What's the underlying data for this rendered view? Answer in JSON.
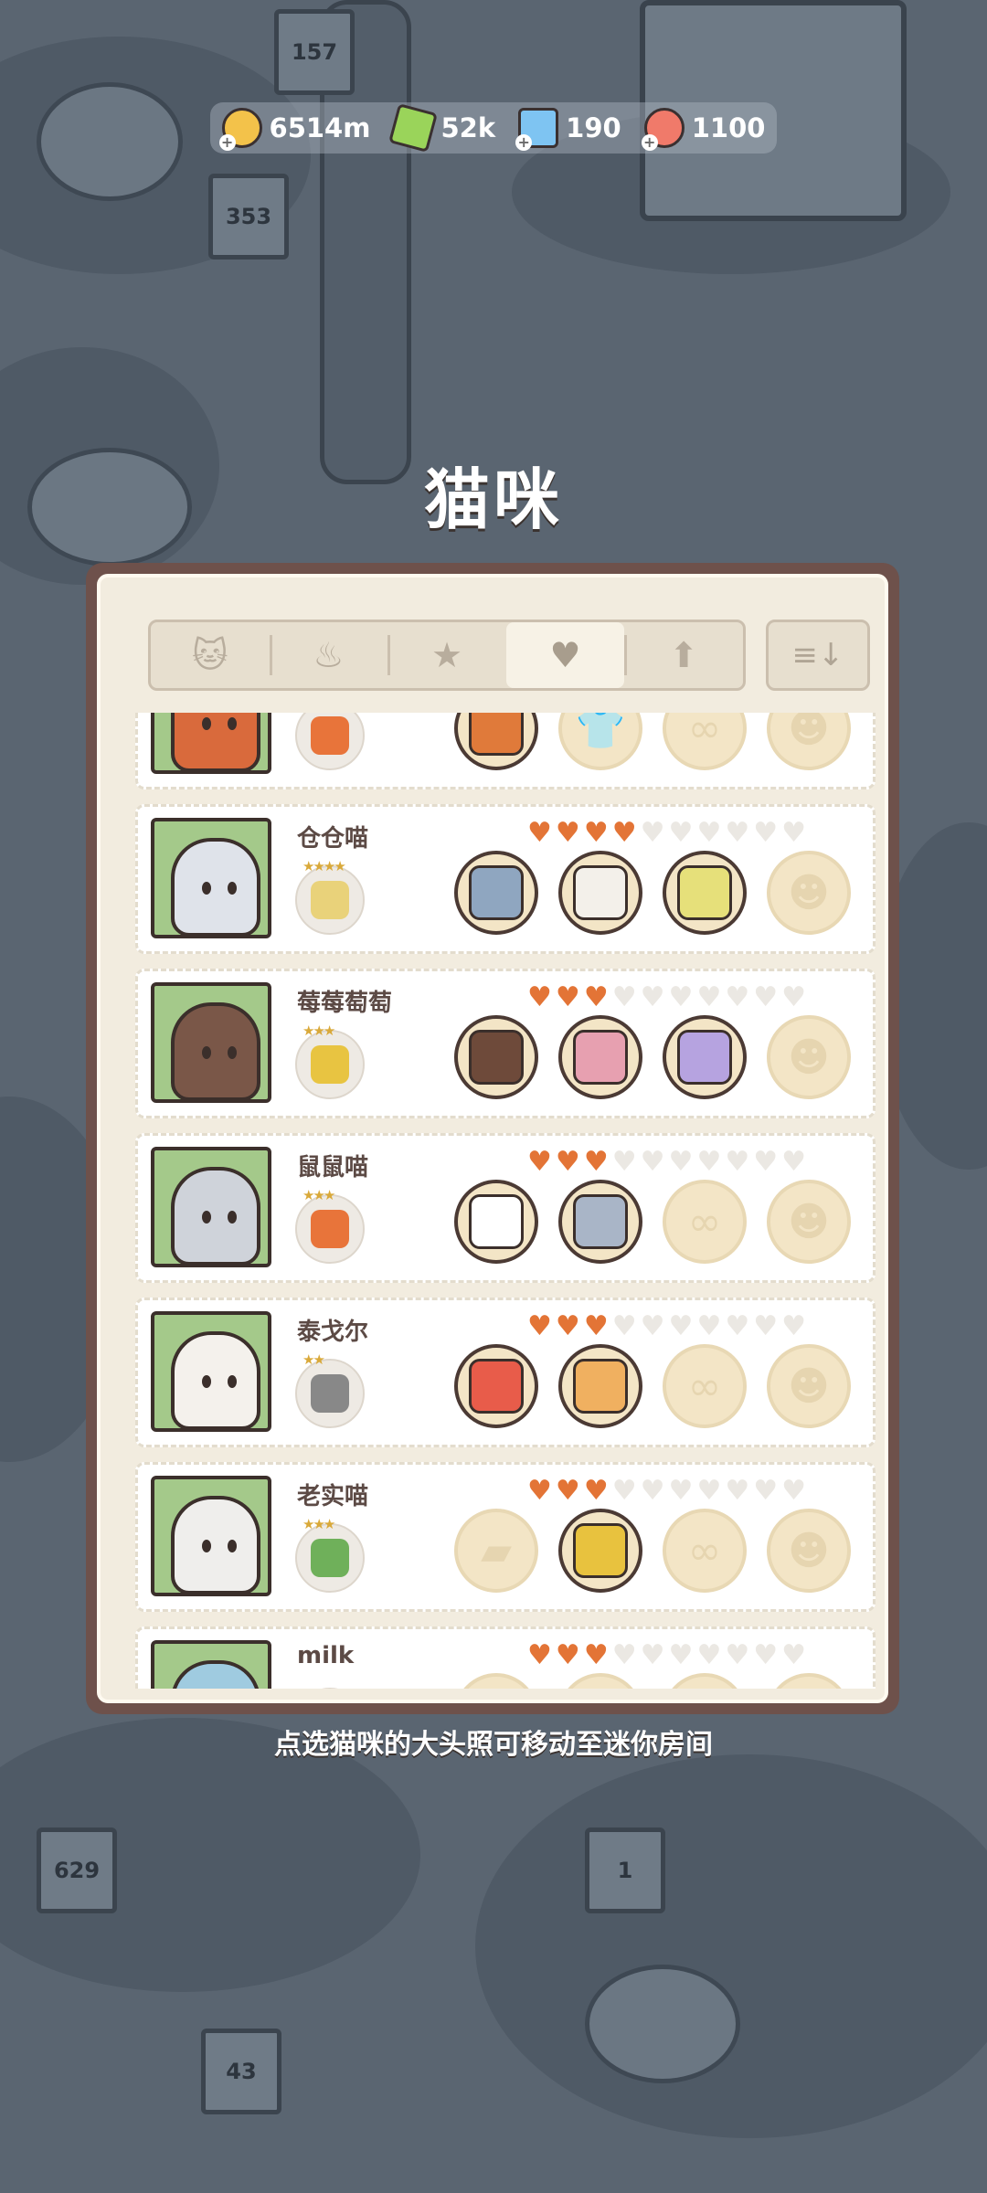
{
  "currency": {
    "coins": "6514m",
    "energy": "52k",
    "gems": "190",
    "shells": "1100"
  },
  "title": "猫咪",
  "tabs": [
    {
      "icon": "cat-icon",
      "glyph": "🐱"
    },
    {
      "icon": "chef-hat-icon",
      "glyph": "♨"
    },
    {
      "icon": "star-icon",
      "glyph": "★"
    },
    {
      "icon": "heart-icon",
      "glyph": "♥"
    },
    {
      "icon": "arrow-up-icon",
      "glyph": "⬆"
    }
  ],
  "sort_glyph": "≡↓",
  "cats": [
    {
      "name": "",
      "hearts": 0,
      "portrait_color": "#d96a3c",
      "food_stars": "★★★",
      "food_color": "#e8743a",
      "slots": [
        "#e07a3a",
        "",
        "",
        ""
      ]
    },
    {
      "name": "仓仓喵",
      "hearts": 4,
      "portrait_color": "#dfe3ea",
      "food_stars": "★★★★",
      "food_color": "#e9d27a",
      "slots": [
        "#8fa6c0",
        "#f3f0ea",
        "#e6e07a",
        ""
      ]
    },
    {
      "name": "莓莓萄萄",
      "hearts": 3,
      "portrait_color": "#7a5748",
      "food_stars": "★★★",
      "food_color": "#e8c441",
      "slots": [
        "#6e4a3a",
        "#e7a0b0",
        "#b6a3e0",
        ""
      ]
    },
    {
      "name": "鼠鼠喵",
      "hearts": 3,
      "portrait_color": "#cfd3da",
      "food_stars": "★★★",
      "food_color": "#e8743a",
      "slots": [
        "#ffffff",
        "#a9b5c7",
        "",
        ""
      ]
    },
    {
      "name": "泰戈尔",
      "hearts": 3,
      "portrait_color": "#f4f1ec",
      "food_stars": "★★",
      "food_color": "#888888",
      "slots": [
        "#e85c4a",
        "#f0b060",
        "",
        ""
      ]
    },
    {
      "name": "老实喵",
      "hearts": 3,
      "portrait_color": "#efeeec",
      "food_stars": "★★★",
      "food_color": "#6fb05a",
      "slots": [
        "",
        "#e8c23e",
        "",
        ""
      ]
    },
    {
      "name": "milk",
      "hearts": 3,
      "portrait_color": "#9fcbe0",
      "food_stars": "",
      "food_color": "#ffffff",
      "slots": [
        "",
        "",
        "",
        ""
      ]
    }
  ],
  "hint": "点选猫咪的大头照可移动至迷你房间"
}
